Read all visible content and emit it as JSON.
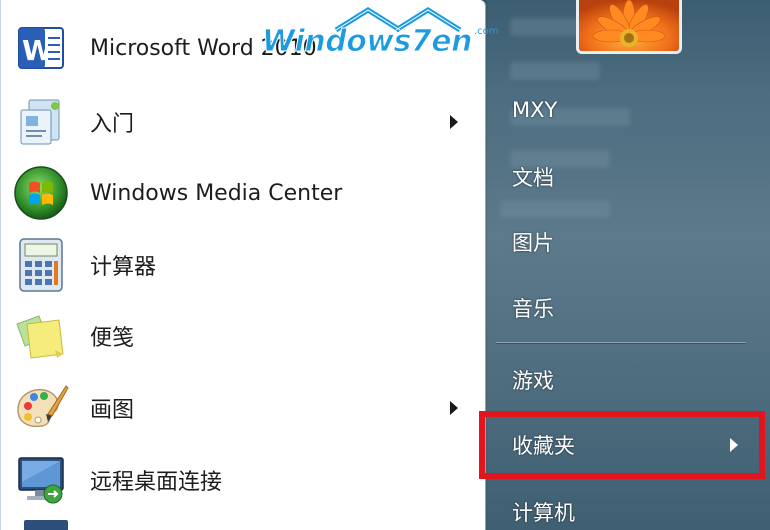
{
  "programs": [
    {
      "id": "word",
      "label": "Microsoft Word 2010",
      "icon": "word-icon",
      "has_submenu": false
    },
    {
      "id": "getting-started",
      "label": "入门",
      "icon": "getting-started-icon",
      "has_submenu": true
    },
    {
      "id": "media-center",
      "label": "Windows Media Center",
      "icon": "media-center-icon",
      "has_submenu": false
    },
    {
      "id": "calculator",
      "label": "计算器",
      "icon": "calculator-icon",
      "has_submenu": false
    },
    {
      "id": "sticky-notes",
      "label": "便笺",
      "icon": "sticky-notes-icon",
      "has_submenu": false
    },
    {
      "id": "paint",
      "label": "画图",
      "icon": "paint-icon",
      "has_submenu": true
    },
    {
      "id": "remote-desktop",
      "label": "远程桌面连接",
      "icon": "remote-desktop-icon",
      "has_submenu": false
    }
  ],
  "places": [
    {
      "id": "user",
      "label": "MXY",
      "has_submenu": false
    },
    {
      "id": "documents",
      "label": "文档",
      "has_submenu": false
    },
    {
      "id": "pictures",
      "label": "图片",
      "has_submenu": false
    },
    {
      "id": "music",
      "label": "音乐",
      "has_submenu": false
    },
    {
      "id": "games",
      "label": "游戏",
      "has_submenu": false
    },
    {
      "id": "favorites",
      "label": "收藏夹",
      "has_submenu": true
    },
    {
      "id": "computer",
      "label": "计算机",
      "has_submenu": false
    }
  ],
  "watermark": {
    "text": "Windows7en",
    "domain": ".com"
  },
  "colors": {
    "highlight": "#e4141c",
    "right_pane": "#4f6e80",
    "watermark": "#1c9be0"
  }
}
